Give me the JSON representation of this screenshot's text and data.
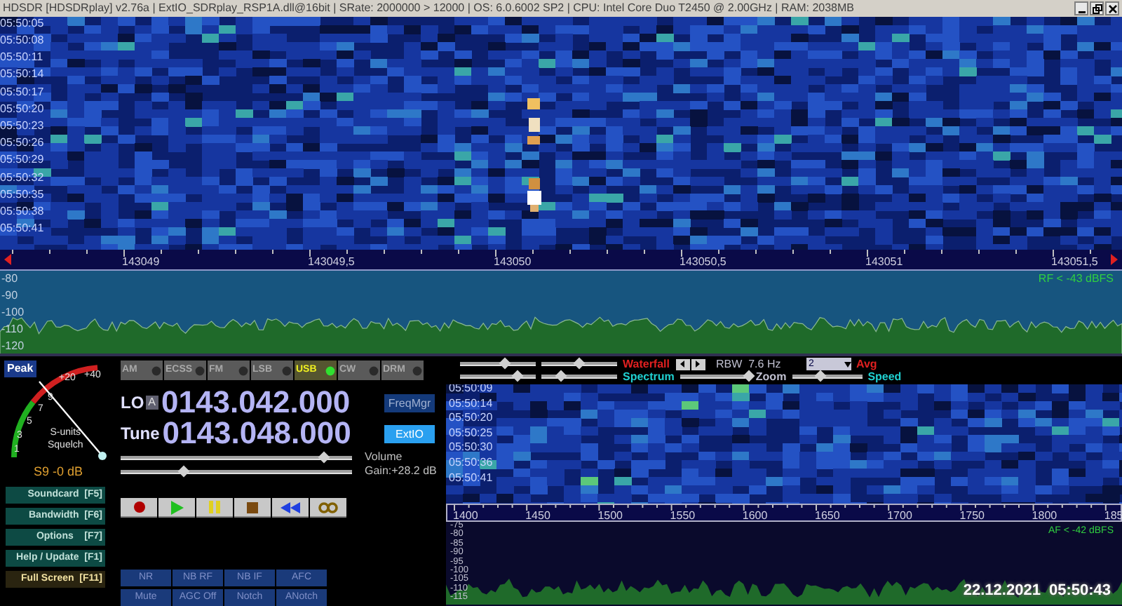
{
  "window": {
    "title": "HDSDR  [HDSDRplay]  v2.76a  |  ExtIO_SDRplay_RSP1A.dll@16bit  |  SRate: 2000000 > 12000  |  OS: 6.0.6002 SP2  |  CPU: Intel Core Duo   T2450  @ 2.00GHz  |  RAM: 2038MB"
  },
  "main_waterfall": {
    "times": [
      "05:50:05",
      "05:50:08",
      "05:50:11",
      "05:50:14",
      "05:50:17",
      "05:50:20",
      "05:50:23",
      "05:50:26",
      "05:50:29",
      "05:50:32",
      "05:50:35",
      "05:50:38",
      "05:50:41"
    ]
  },
  "frequency_axis": {
    "labels": [
      "143049",
      "143049,5",
      "143050",
      "143050,5",
      "143051",
      "143051,5"
    ]
  },
  "rf_spectrum": {
    "scale": [
      "-80",
      "-90",
      "-100",
      "-110",
      "-120"
    ],
    "reading": "RF < -43 dBFS"
  },
  "s_meter": {
    "peak_button": "Peak",
    "scale": [
      "+20",
      "+40",
      "9",
      "7",
      "5",
      "3",
      "1"
    ],
    "label_lines": [
      "S-units",
      "Squelch"
    ],
    "reading": "S9 -0 dB"
  },
  "modes": [
    {
      "label": "AM",
      "selected": false
    },
    {
      "label": "ECSS",
      "selected": false
    },
    {
      "label": "FM",
      "selected": false
    },
    {
      "label": "LSB",
      "selected": false
    },
    {
      "label": "USB",
      "selected": true
    },
    {
      "label": "CW",
      "selected": false
    },
    {
      "label": "DRM",
      "selected": false
    }
  ],
  "lo": {
    "label": "LO",
    "bank": "A",
    "frequency": "0143.042.000"
  },
  "tune": {
    "label": "Tune",
    "frequency": "0143.048.000"
  },
  "side_buttons": [
    {
      "label": "FreqMgr",
      "selected": false
    },
    {
      "label": "ExtIO",
      "selected": true
    }
  ],
  "volume": {
    "label": "Volume",
    "level": 0.88
  },
  "gain": {
    "reading": "Gain:+28.2 dB",
    "level": 0.27
  },
  "transport": [
    {
      "kind": "record"
    },
    {
      "kind": "play"
    },
    {
      "kind": "pause"
    },
    {
      "kind": "stop"
    },
    {
      "kind": "rewind"
    },
    {
      "kind": "loop"
    }
  ],
  "menu_buttons": [
    {
      "label": "Soundcard  [F5]",
      "selected": false
    },
    {
      "label": "Bandwidth  [F6]",
      "selected": false
    },
    {
      "label": "Options    [F7]",
      "selected": false
    },
    {
      "label": "Help / Update  [F1]",
      "selected": false
    },
    {
      "label": "Full Screen  [F11]",
      "selected": true
    }
  ],
  "dsp_buttons": [
    "NR",
    "NB RF",
    "NB IF",
    "AFC",
    "Mute",
    "AGC Off",
    "Notch",
    "ANotch"
  ],
  "display_controls": {
    "waterfall": "Waterfall",
    "spectrum": "Spectrum",
    "rbw": "RBW  7.6 Hz",
    "avg_value": "2",
    "avg": "Avg",
    "zoom": "Zoom",
    "speed": "Speed",
    "waterfall_sliders": [
      {
        "level": 0.6
      },
      {
        "level": 0.5
      }
    ],
    "spectrum_sliders": [
      {
        "level": 0.75
      },
      {
        "level": 0.25
      }
    ],
    "zoom_slider": {
      "level": 0.98
    },
    "speed_slider": {
      "level": 0.4
    }
  },
  "small_waterfall": {
    "times": [
      "05:50:09",
      "05:50:14",
      "05:50:20",
      "05:50:25",
      "05:50:30",
      "05:50:36",
      "05:50:41"
    ]
  },
  "audio_axis": {
    "labels": [
      "1400",
      "1450",
      "1500",
      "1550",
      "1600",
      "1650",
      "1700",
      "1750",
      "1800",
      "185"
    ]
  },
  "af_spectrum": {
    "scale": [
      "-75",
      "-80",
      "-85",
      "-90",
      "-95",
      "-100",
      "-105",
      "-110",
      "-115"
    ],
    "reading": "AF < -42 dBFS"
  },
  "timestamp": {
    "date": "22.12.2021",
    "time": "05:50:43"
  }
}
